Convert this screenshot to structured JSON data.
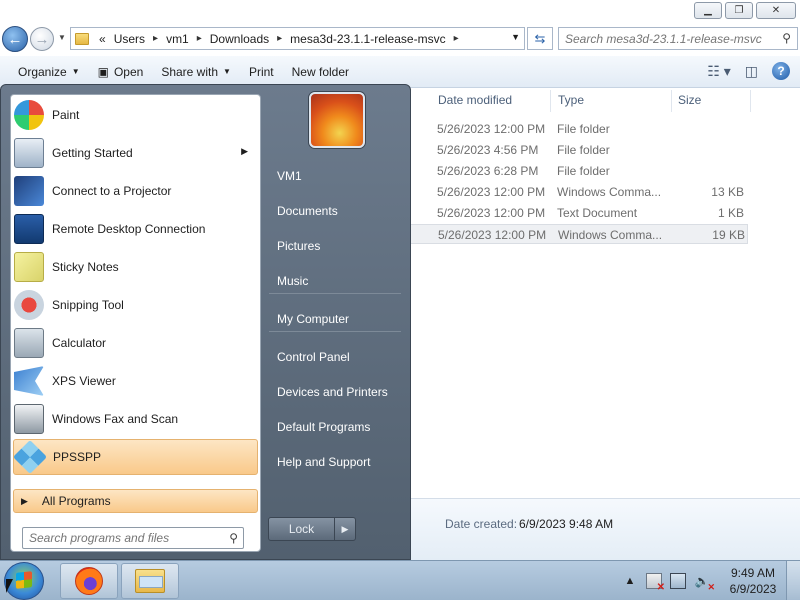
{
  "explorer": {
    "window_buttons": {
      "minimize": "▁",
      "maximize": "❐",
      "close": "✕"
    },
    "address": {
      "crumbs": [
        "«",
        "Users",
        "vm1",
        "Downloads",
        "mesa3d-23.1.1-release-msvc"
      ]
    },
    "search": {
      "placeholder": "Search mesa3d-23.1.1-release-msvc"
    },
    "toolbar": {
      "organize": "Organize",
      "open": "Open",
      "share_with": "Share with",
      "print": "Print",
      "new_folder": "New folder"
    },
    "columns": {
      "date": "Date modified",
      "type": "Type",
      "size": "Size"
    },
    "files": [
      {
        "date": "5/26/2023 12:00 PM",
        "type": "File folder",
        "size": ""
      },
      {
        "date": "5/26/2023 4:56 PM",
        "type": "File folder",
        "size": ""
      },
      {
        "date": "5/26/2023 6:28 PM",
        "type": "File folder",
        "size": ""
      },
      {
        "date": "5/26/2023 12:00 PM",
        "type": "Windows Comma...",
        "size": "13 KB"
      },
      {
        "date": "5/26/2023 12:00 PM",
        "type": "Text Document",
        "size": "1 KB"
      },
      {
        "date": "5/26/2023 12:00 PM",
        "type": "Windows Comma...",
        "size": "19 KB"
      }
    ],
    "selected_row_index": 5,
    "details": {
      "label": "Date created:",
      "value": "6/9/2023 9:48 AM"
    }
  },
  "start_menu": {
    "programs": [
      {
        "name": "Paint",
        "icon": "paint-icon"
      },
      {
        "name": "Getting Started",
        "icon": "getting-started-icon",
        "has_submenu": true
      },
      {
        "name": "Connect to a Projector",
        "icon": "projector-icon"
      },
      {
        "name": "Remote Desktop Connection",
        "icon": "remote-desktop-icon"
      },
      {
        "name": "Sticky Notes",
        "icon": "sticky-notes-icon"
      },
      {
        "name": "Snipping Tool",
        "icon": "snipping-tool-icon"
      },
      {
        "name": "Calculator",
        "icon": "calculator-icon"
      },
      {
        "name": "XPS Viewer",
        "icon": "xps-viewer-icon"
      },
      {
        "name": "Windows Fax and Scan",
        "icon": "fax-scan-icon"
      },
      {
        "name": "PPSSPP",
        "icon": "ppsspp-icon",
        "highlighted": true
      }
    ],
    "all_programs": "All Programs",
    "search_placeholder": "Search programs and files",
    "right_items": [
      "VM1",
      "Documents",
      "Pictures",
      "Music",
      "My Computer",
      "Control Panel",
      "Devices and Printers",
      "Default Programs",
      "Help and Support"
    ],
    "lock_label": "Lock"
  },
  "taskbar": {
    "time": "9:49 AM",
    "date": "6/9/2023"
  },
  "colors": {
    "start_menu_bg": "#5f6d7e",
    "highlight": "#f9c98a",
    "toolbar_bg": "#e2ebf5"
  }
}
